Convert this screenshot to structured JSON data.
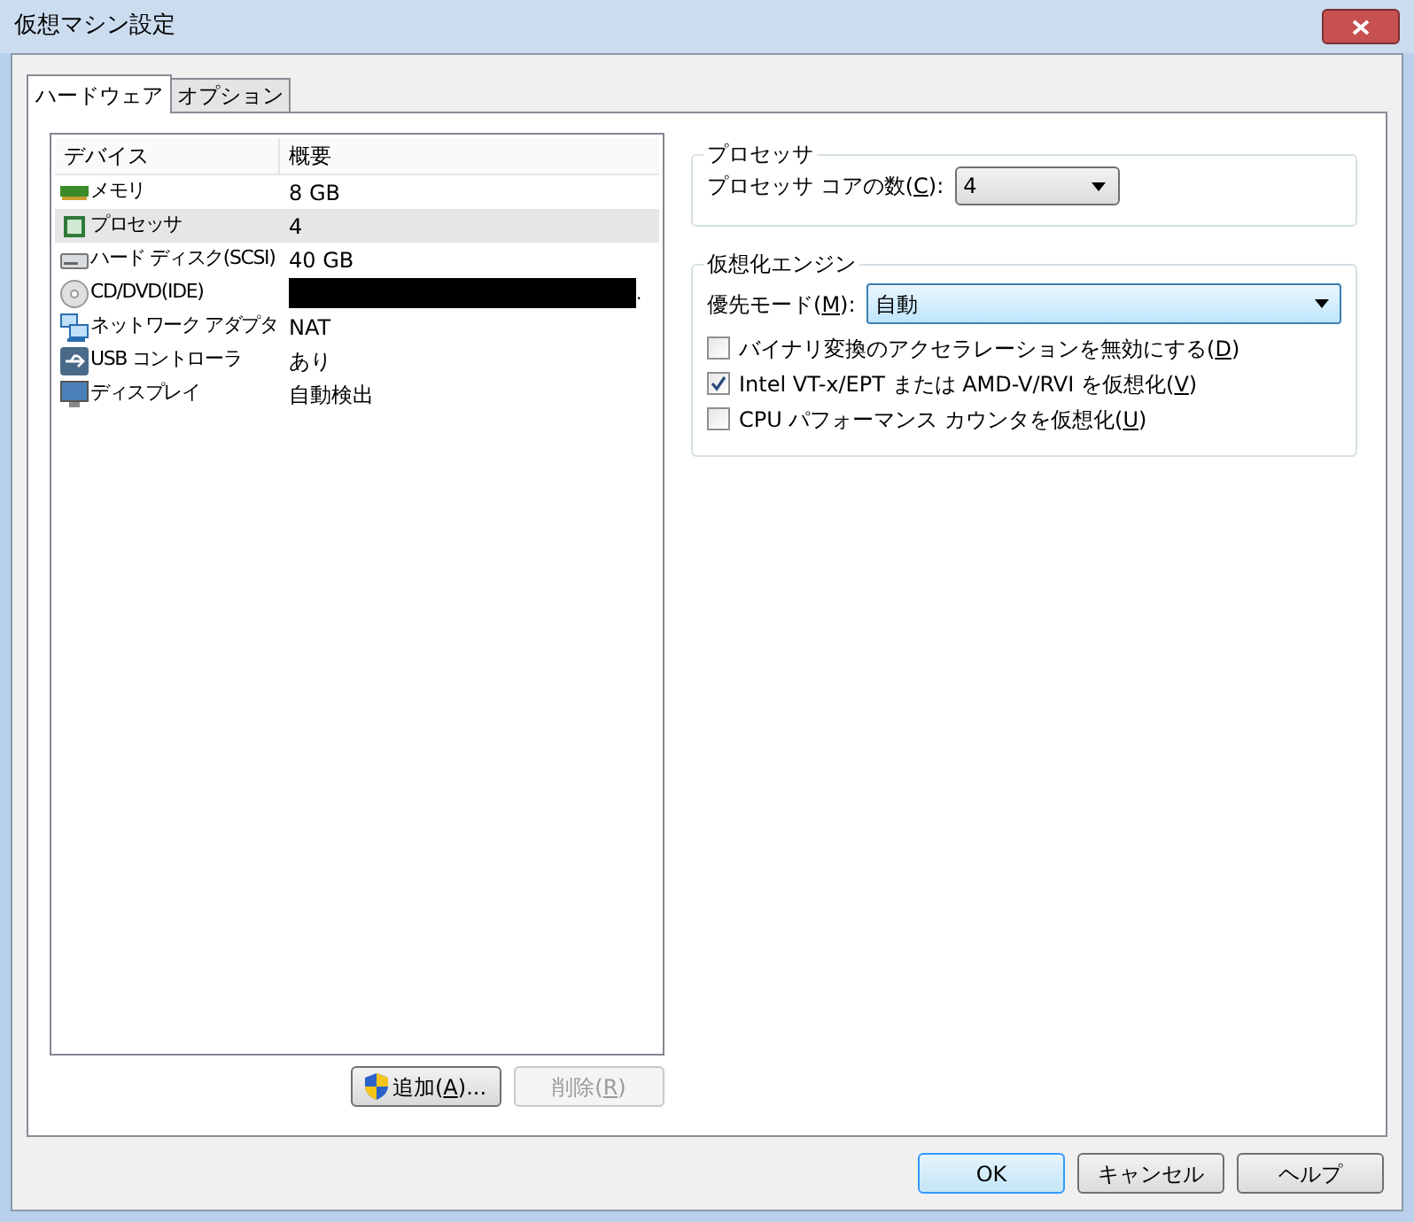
{
  "window": {
    "title": "仮想マシン設定"
  },
  "tabs": [
    {
      "label": "ハードウェア",
      "selected": true
    },
    {
      "label": "オプション",
      "selected": false
    }
  ],
  "device_list": {
    "columns": [
      "デバイス",
      "概要"
    ],
    "rows": [
      {
        "kind": "memory",
        "device": "メモリ",
        "summary": "8 GB",
        "selected": false,
        "redacted": false
      },
      {
        "kind": "processor",
        "device": "プロセッサ",
        "summary": "4",
        "selected": true,
        "redacted": false
      },
      {
        "kind": "disk",
        "device": "ハード ディスク(SCSI)",
        "summary": "40 GB",
        "selected": false,
        "redacted": false
      },
      {
        "kind": "cd",
        "device": "CD/DVD(IDE)",
        "summary": ".",
        "selected": false,
        "redacted": true
      },
      {
        "kind": "network",
        "device": "ネットワーク アダプタ",
        "summary": "NAT",
        "selected": false,
        "redacted": false
      },
      {
        "kind": "usb",
        "device": "USB コントローラ",
        "summary": "あり",
        "selected": false,
        "redacted": false
      },
      {
        "kind": "display",
        "device": "ディスプレイ",
        "summary": "自動検出",
        "selected": false,
        "redacted": false
      }
    ]
  },
  "list_buttons": [
    {
      "kind": "shield",
      "label": [
        "追加(",
        "A",
        ")..."
      ],
      "disabled": false
    },
    {
      "kind": "plain",
      "label": [
        "削除(",
        "R",
        ")"
      ],
      "disabled": true
    }
  ],
  "processor_group": {
    "title": "プロセッサ",
    "cores_label": [
      "プロセッサ コアの数(",
      "C",
      "):"
    ],
    "cores_value": "4"
  },
  "virtualization_group": {
    "title": "仮想化エンジン",
    "mode_label": [
      "優先モード(",
      "M",
      "):"
    ],
    "mode_value": "自動",
    "options": [
      {
        "label": [
          "バイナリ変換のアクセラレーションを無効にする(",
          "D",
          ")"
        ],
        "checked": false
      },
      {
        "label": [
          "Intel VT-x/EPT または AMD-V/RVI を仮想化(",
          "V",
          ")"
        ],
        "checked": true
      },
      {
        "label": [
          "CPU パフォーマンス カウンタを仮想化(",
          "U",
          ")"
        ],
        "checked": false
      }
    ]
  },
  "dialog_buttons": [
    {
      "label": "OK",
      "default": true
    },
    {
      "label": "キャンセル",
      "default": false
    },
    {
      "label": "ヘルプ",
      "default": false
    }
  ]
}
